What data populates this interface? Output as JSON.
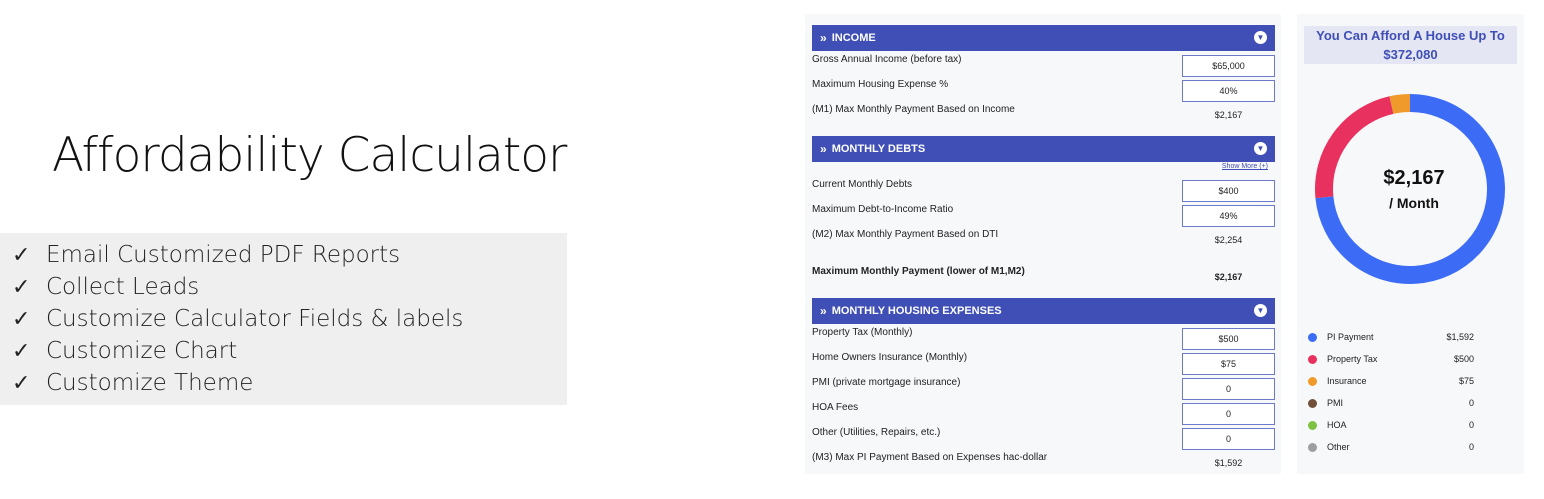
{
  "title": "Affordability Calculator",
  "features": [
    "Email Customized PDF Reports",
    "Collect Leads",
    "Customize Calculator Fields & labels",
    "Customize Chart",
    "Customize Theme"
  ],
  "check_glyph": "✓",
  "income": {
    "header": "INCOME",
    "gross_label": "Gross Annual Income (before tax)",
    "gross_value": "$65,000",
    "housing_label": "Maximum Housing Expense %",
    "housing_value": "40%",
    "m1_label": "(M1) Max Monthly Payment Based on Income",
    "m1_value": "$2,167"
  },
  "debts": {
    "header": "MONTHLY DEBTS",
    "show_more": "Show More (+)",
    "current_label": "Current Monthly Debts",
    "current_value": "$400",
    "dti_label": "Maximum Debt-to-Income Ratio",
    "dti_value": "49%",
    "m2_label": "(M2) Max Monthly Payment Based on DTI",
    "m2_value": "$2,254",
    "max_label": "Maximum Monthly Payment (lower of M1,M2)",
    "max_value": "$2,167"
  },
  "housing": {
    "header": "MONTHLY HOUSING EXPENSES",
    "tax_label": "Property Tax (Monthly)",
    "tax_value": "$500",
    "ins_label": "Home Owners Insurance (Monthly)",
    "ins_value": "$75",
    "pmi_label": "PMI (private mortgage insurance)",
    "pmi_value": "0",
    "hoa_label": "HOA Fees",
    "hoa_value": "0",
    "other_label": "Other (Utilities, Repairs, etc.)",
    "other_value": "0",
    "m3_label": "(M3) Max PI Payment Based on Expenses hac-dollar",
    "m3_value": "$1,592"
  },
  "result": {
    "line1": "You Can Afford A House Up To",
    "line2": "$372,080",
    "center_amount": "$2,167",
    "center_sub": "/ Month"
  },
  "chart_data": {
    "type": "pie",
    "categories": [
      "PI Payment",
      "Property Tax",
      "Insurance",
      "PMI",
      "HOA",
      "Other"
    ],
    "values": [
      1592,
      500,
      75,
      0,
      0,
      0
    ],
    "display_values": [
      "$1,592",
      "$500",
      "$75",
      "0",
      "0",
      "0"
    ],
    "colors": [
      "#3c6cf5",
      "#e8315e",
      "#ef9a2a",
      "#70503a",
      "#7dc242",
      "#9e9e9e"
    ]
  },
  "colors": {
    "accent": "#3f4fb6"
  }
}
